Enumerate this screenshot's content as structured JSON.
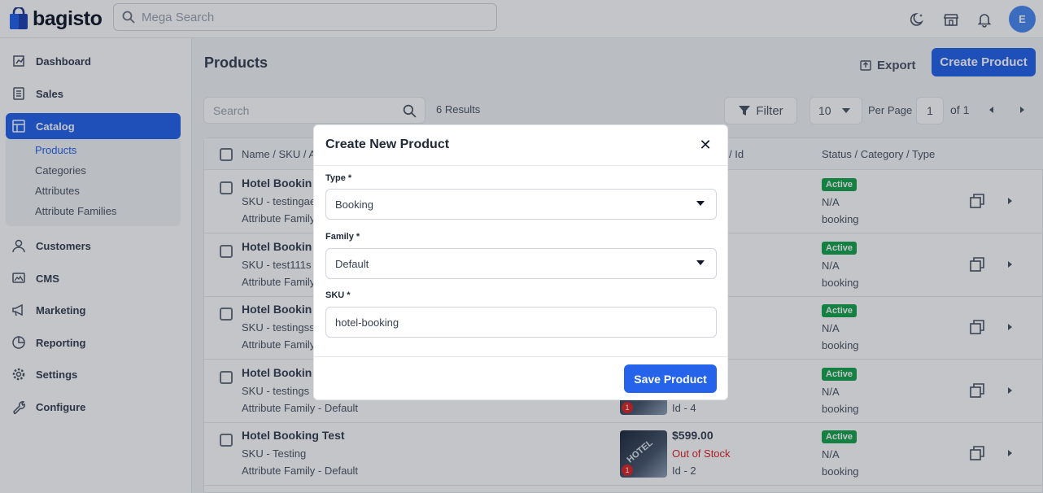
{
  "header": {
    "brand": "bagisto",
    "search_placeholder": "Mega Search",
    "avatar_initial": "E"
  },
  "sidebar": {
    "items": [
      {
        "label": "Dashboard"
      },
      {
        "label": "Sales"
      },
      {
        "label": "Catalog"
      },
      {
        "label": "Customers"
      },
      {
        "label": "CMS"
      },
      {
        "label": "Marketing"
      },
      {
        "label": "Reporting"
      },
      {
        "label": "Settings"
      },
      {
        "label": "Configure"
      }
    ],
    "catalog_sub": [
      "Products",
      "Categories",
      "Attributes",
      "Attribute Families"
    ]
  },
  "main": {
    "title": "Products",
    "export_label": "Export",
    "create_label": "Create Product",
    "search_placeholder": "Search",
    "results": "6 Results",
    "filter_label": "Filter",
    "per_page_value": "10",
    "per_page_label": "Per Page",
    "page_value": "1",
    "page_of": "of 1",
    "columns": [
      "Name / SKU / A",
      "/ Id",
      "Status / Category / Type"
    ]
  },
  "rows": [
    {
      "name": "Hotel Bookin",
      "sku": "SKU - testingae",
      "family": "Attribute Family",
      "price": "",
      "stock": "",
      "id": "",
      "status": "Active",
      "category": "N/A",
      "type": "booking"
    },
    {
      "name": "Hotel Bookin",
      "sku": "SKU - test111s",
      "family": "Attribute Family",
      "price": "",
      "stock": "",
      "id": "",
      "status": "Active",
      "category": "N/A",
      "type": "booking"
    },
    {
      "name": "Hotel Bookin",
      "sku": "SKU - testingss",
      "family": "Attribute Family",
      "price": "",
      "stock": "",
      "id": "",
      "status": "Active",
      "category": "N/A",
      "type": "booking"
    },
    {
      "name": "Hotel Bookin",
      "sku": "SKU - testings",
      "family": "Attribute Family - Default",
      "price": "",
      "stock": "",
      "id": "Id - 4",
      "status": "Active",
      "category": "N/A",
      "type": "booking"
    },
    {
      "name": "Hotel Booking Test",
      "sku": "SKU - Testing",
      "family": "Attribute Family - Default",
      "price": "$599.00",
      "stock": "Out of Stock",
      "id": "Id - 2",
      "status": "Active",
      "category": "N/A",
      "type": "booking"
    }
  ],
  "image_badge": "1",
  "image_caption": "HOTEL",
  "modal": {
    "title": "Create New Product",
    "type_label": "Type *",
    "type_value": "Booking",
    "family_label": "Family *",
    "family_value": "Default",
    "sku_label": "SKU *",
    "sku_value": "hotel-booking",
    "save_label": "Save Product"
  },
  "colors": {
    "primary": "#2563eb",
    "active_badge": "#16a34a",
    "out_of_stock": "#dc2626"
  }
}
